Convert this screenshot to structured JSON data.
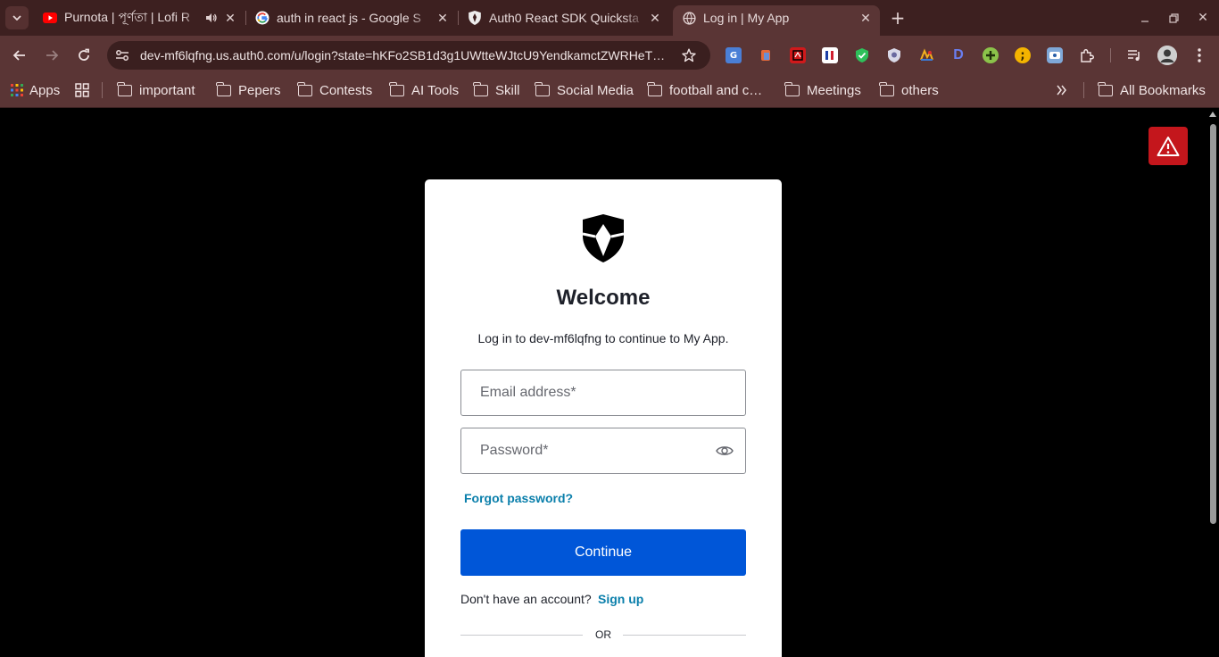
{
  "browser": {
    "tabs": [
      {
        "title": "Purnota | পূর্ণতা | Lofi R",
        "favicon": "youtube-icon",
        "audio": true
      },
      {
        "title": "auth in react js - Google S",
        "favicon": "google-icon"
      },
      {
        "title": "Auth0 React SDK Quicksta",
        "favicon": "auth0-icon"
      },
      {
        "title": "Log in | My App",
        "favicon": "globe-icon",
        "active": true
      }
    ],
    "url": "dev-mf6lqfng.us.auth0.com/u/login?state=hKFo2SB1d3g1UWtteWJtcU9YendkamctZWRHeT…",
    "bookmarks": {
      "apps_label": "Apps",
      "folders": [
        "important",
        "Pepers",
        "Contests",
        "AI Tools",
        "Skill",
        "Social Media",
        "football and c…",
        "Meetings",
        "others"
      ],
      "all_bookmarks_label": "All Bookmarks"
    }
  },
  "login": {
    "title": "Welcome",
    "subtitle": "Log in to dev-mf6lqfng to continue to My App.",
    "email_placeholder": "Email address*",
    "password_placeholder": "Password*",
    "forgot_password": "Forgot password?",
    "continue_label": "Continue",
    "no_account_text": "Don't have an account?",
    "signup_label": "Sign up",
    "or_label": "OR"
  },
  "colors": {
    "primary_button": "#0056d8",
    "link": "#0a7fab",
    "alert": "#c4161c"
  }
}
